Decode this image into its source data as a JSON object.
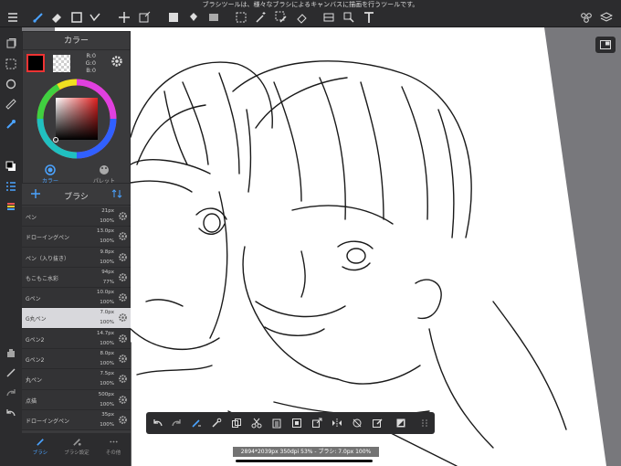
{
  "tooltip": "ブラシツールは、様々なブラシによるキャンバスに描画を行うツールです。",
  "color_panel": {
    "title": "カラー",
    "rgb": [
      "R:0",
      "G:0",
      "B:0"
    ],
    "tabs": [
      {
        "label": "カラー"
      },
      {
        "label": "パレット"
      }
    ]
  },
  "brush_panel": {
    "title": "ブラシ",
    "items": [
      {
        "name": "ペン",
        "size": "21px",
        "opacity": "100%"
      },
      {
        "name": "ドローイングペン",
        "size": "13.0px",
        "opacity": "100%"
      },
      {
        "name": "ペン（入り抜き）",
        "size": "9.8px",
        "opacity": "100%"
      },
      {
        "name": "もこもこ水彩",
        "size": "94px",
        "opacity": "77%"
      },
      {
        "name": "Gペン",
        "size": "10.0px",
        "opacity": "100%"
      },
      {
        "name": "G丸ペン",
        "size": "7.0px",
        "opacity": "100%"
      },
      {
        "name": "Gペン2",
        "size": "14.7px",
        "opacity": "100%"
      },
      {
        "name": "Gペン2",
        "size": "8.0px",
        "opacity": "100%"
      },
      {
        "name": "丸ペン",
        "size": "7.5px",
        "opacity": "100%"
      },
      {
        "name": "点描",
        "size": "500px",
        "opacity": "100%"
      },
      {
        "name": "ドローイングペン",
        "size": "35px",
        "opacity": "100%"
      }
    ],
    "tabs": [
      {
        "label": "ブラシ"
      },
      {
        "label": "ブラシ設定"
      },
      {
        "label": "その他"
      }
    ]
  },
  "status_bar": "2894*2039px 350dpi 53% - ブラシ: 7.0px 100%",
  "colors": {
    "accent": "#4ba3ff",
    "toolbar_bg": "#2c2c2e",
    "panel_bg": "#3a3a3c",
    "canvas_bg": "#78787c"
  },
  "icons": {
    "top": [
      "menu-icon",
      "brush-icon",
      "eraser-icon",
      "rect-select-icon",
      "magic-pen-icon",
      "move-icon",
      "transform-icon",
      "fill-color-icon",
      "bucket-icon",
      "gradient-icon",
      "select-icon",
      "magic-wand-icon",
      "select-pen-icon",
      "select-eraser-icon",
      "frame-icon",
      "text-type-icon",
      "text-icon",
      "material-icon",
      "layers-icon"
    ],
    "rail": [
      "layers-list-icon",
      "selection-icon",
      "rotate-icon",
      "ruler-icon",
      "eyedropper-icon",
      "color-swatch-icon",
      "list-icon",
      "stack-icon",
      "hand-icon",
      "pen-icon",
      "redo-icon",
      "undo-icon"
    ],
    "bottom": [
      "undo-icon",
      "redo-icon",
      "brush-adjust-icon",
      "eyedropper-icon",
      "copy-icon",
      "cut-icon",
      "paste-icon",
      "clear-icon",
      "transform-icon",
      "flip-icon",
      "rotate-lock-icon",
      "edit-icon",
      "fill-icon",
      "more-icon"
    ]
  }
}
